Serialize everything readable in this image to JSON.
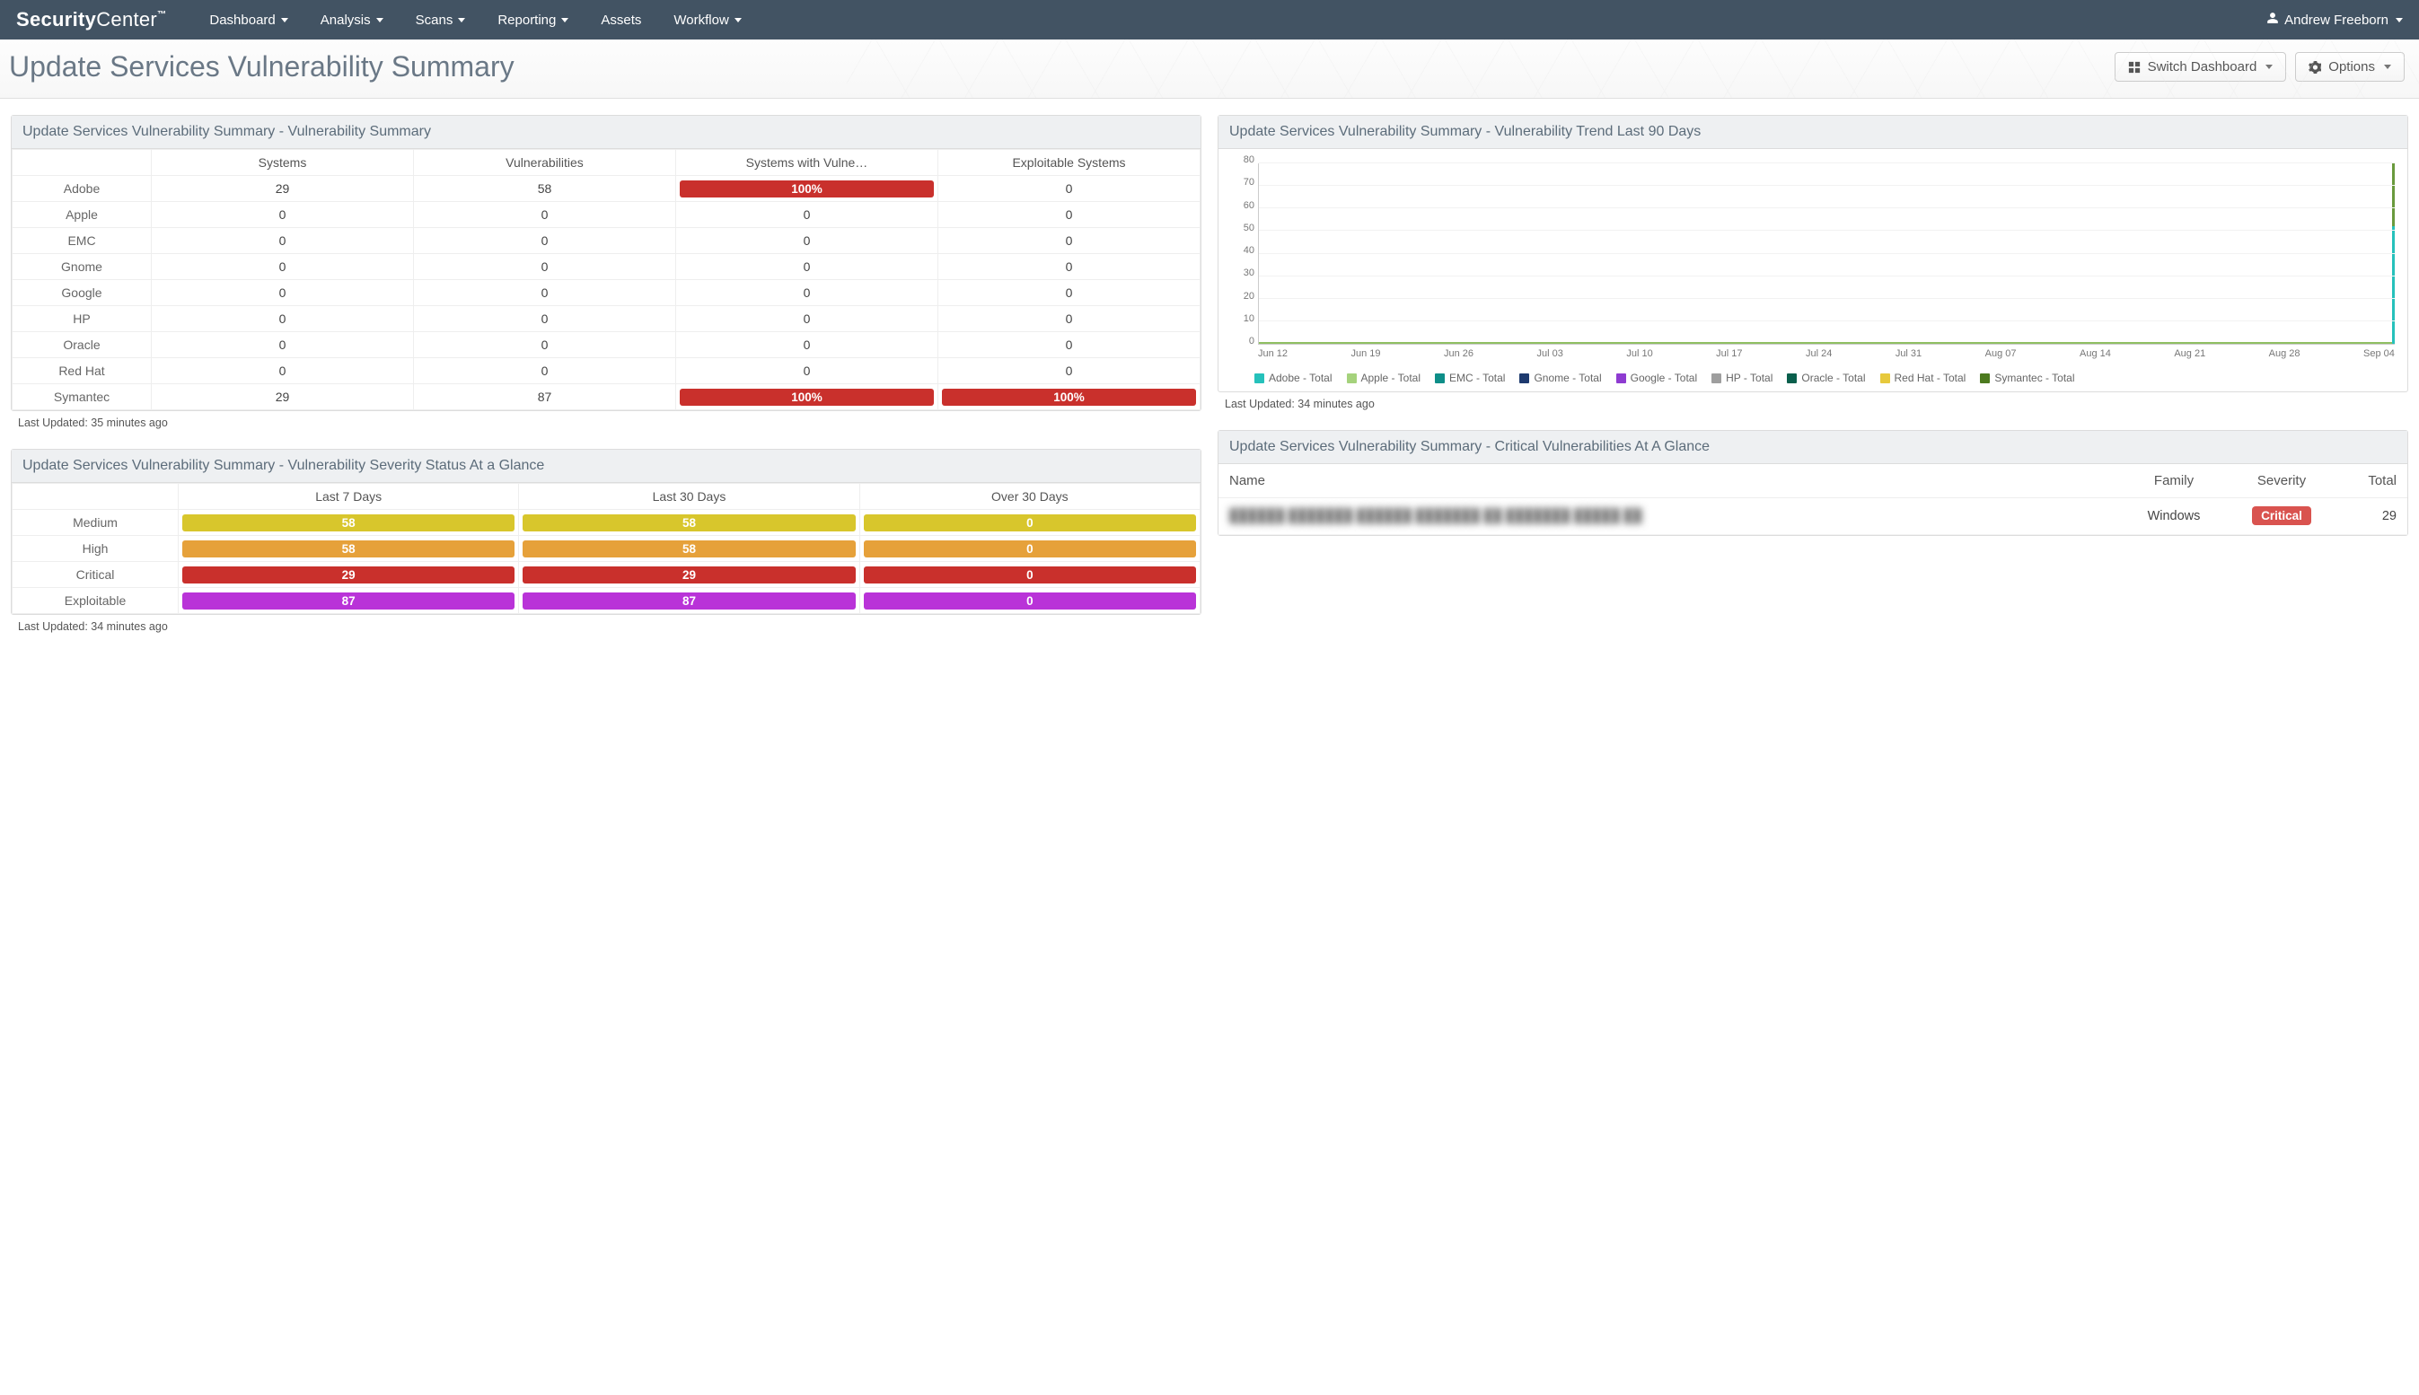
{
  "brand": {
    "strong": "Security",
    "light": "Center",
    "mark": "™"
  },
  "nav": {
    "items": [
      {
        "label": "Dashboard",
        "caret": true
      },
      {
        "label": "Analysis",
        "caret": true
      },
      {
        "label": "Scans",
        "caret": true
      },
      {
        "label": "Reporting",
        "caret": true
      },
      {
        "label": "Assets",
        "caret": false
      },
      {
        "label": "Workflow",
        "caret": true
      }
    ],
    "user": "Andrew Freeborn"
  },
  "page": {
    "title": "Update Services Vulnerability Summary",
    "switch_label": "Switch Dashboard",
    "options_label": "Options"
  },
  "summary_panel": {
    "title": "Update Services Vulnerability Summary - Vulnerability Summary",
    "columns": [
      "",
      "Systems",
      "Vulnerabilities",
      "Systems with Vulne…",
      "Exploitable Systems"
    ],
    "rows": [
      {
        "label": "Adobe",
        "systems": "29",
        "vulns": "58",
        "swv": {
          "type": "bar",
          "text": "100%",
          "color": "red"
        },
        "exp": "0"
      },
      {
        "label": "Apple",
        "systems": "0",
        "vulns": "0",
        "swv": "0",
        "exp": "0"
      },
      {
        "label": "EMC",
        "systems": "0",
        "vulns": "0",
        "swv": "0",
        "exp": "0"
      },
      {
        "label": "Gnome",
        "systems": "0",
        "vulns": "0",
        "swv": "0",
        "exp": "0"
      },
      {
        "label": "Google",
        "systems": "0",
        "vulns": "0",
        "swv": "0",
        "exp": "0"
      },
      {
        "label": "HP",
        "systems": "0",
        "vulns": "0",
        "swv": "0",
        "exp": "0"
      },
      {
        "label": "Oracle",
        "systems": "0",
        "vulns": "0",
        "swv": "0",
        "exp": "0"
      },
      {
        "label": "Red Hat",
        "systems": "0",
        "vulns": "0",
        "swv": "0",
        "exp": "0"
      },
      {
        "label": "Symantec",
        "systems": "29",
        "vulns": "87",
        "swv": {
          "type": "bar",
          "text": "100%",
          "color": "red"
        },
        "exp": {
          "type": "bar",
          "text": "100%",
          "color": "red"
        }
      }
    ],
    "footer": "Last Updated: 35 minutes ago"
  },
  "severity_panel": {
    "title": "Update Services Vulnerability Summary - Vulnerability Severity Status At a Glance",
    "columns": [
      "",
      "Last 7 Days",
      "Last 30 Days",
      "Over 30 Days"
    ],
    "rows": [
      {
        "label": "Medium",
        "color": "yellow",
        "cells": [
          "58",
          "58",
          "0"
        ]
      },
      {
        "label": "High",
        "color": "orange",
        "cells": [
          "58",
          "58",
          "0"
        ]
      },
      {
        "label": "Critical",
        "color": "red",
        "cells": [
          "29",
          "29",
          "0"
        ]
      },
      {
        "label": "Exploitable",
        "color": "purple",
        "cells": [
          "87",
          "87",
          "0"
        ]
      }
    ],
    "footer": "Last Updated: 34 minutes ago"
  },
  "trend_panel": {
    "title": "Update Services Vulnerability Summary - Vulnerability Trend Last 90 Days",
    "footer": "Last Updated: 34 minutes ago"
  },
  "chart_data": {
    "type": "line",
    "title": "Vulnerability Trend Last 90 Days",
    "xlabel": "",
    "ylabel": "",
    "ylim": [
      0,
      80
    ],
    "y_ticks": [
      0,
      10,
      20,
      30,
      40,
      50,
      60,
      70,
      80
    ],
    "x_ticks": [
      "Jun 12",
      "Jun 19",
      "Jun 26",
      "Jul 03",
      "Jul 10",
      "Jul 17",
      "Jul 24",
      "Jul 31",
      "Aug 07",
      "Aug 14",
      "Aug 21",
      "Aug 28",
      "Sep 04"
    ],
    "series": [
      {
        "name": "Adobe - Total",
        "color": "#26c1bb",
        "values_all_zero_until_last": true,
        "last_value": 58
      },
      {
        "name": "Apple - Total",
        "color": "#a5d27c",
        "values_all_zero_until_last": true,
        "last_value": 0
      },
      {
        "name": "EMC - Total",
        "color": "#0e8e88",
        "values_all_zero_until_last": true,
        "last_value": 0
      },
      {
        "name": "Gnome - Total",
        "color": "#1d3a6e",
        "values_all_zero_until_last": true,
        "last_value": 0
      },
      {
        "name": "Google - Total",
        "color": "#8e3bd1",
        "values_all_zero_until_last": true,
        "last_value": 0
      },
      {
        "name": "HP - Total",
        "color": "#9e9e9e",
        "values_all_zero_until_last": true,
        "last_value": 0
      },
      {
        "name": "Oracle - Total",
        "color": "#0a5f4c",
        "values_all_zero_until_last": true,
        "last_value": 0
      },
      {
        "name": "Red Hat - Total",
        "color": "#e7c93c",
        "values_all_zero_until_last": true,
        "last_value": 0
      },
      {
        "name": "Symantec - Total",
        "color": "#4c7a1f",
        "values_all_zero_until_last": true,
        "last_value": 87
      }
    ]
  },
  "critical_panel": {
    "title": "Update Services Vulnerability Summary - Critical Vulnerabilities At A Glance",
    "columns": {
      "name": "Name",
      "family": "Family",
      "severity": "Severity",
      "total": "Total"
    },
    "rows": [
      {
        "name_obscured": "██████ ███████ ██████ ███████ ██ ███████ █████ ██",
        "family": "Windows",
        "severity": "Critical",
        "total": "29"
      }
    ]
  }
}
